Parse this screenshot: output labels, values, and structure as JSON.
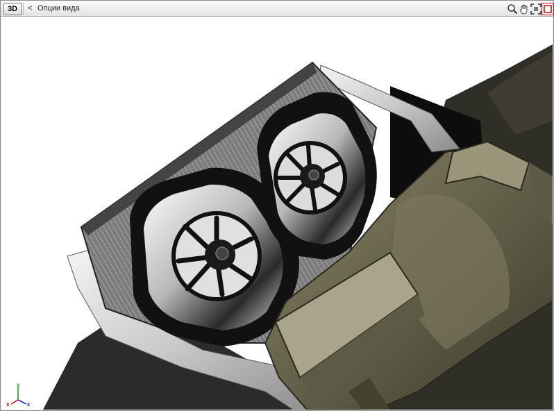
{
  "toolbar": {
    "view3d_label": "3D",
    "back_glyph": "<",
    "view_options_label": "Опции вида",
    "tools": [
      {
        "icon": "zoom-magnifier-icon"
      },
      {
        "icon": "pan-hand-icon"
      },
      {
        "icon": "fit-view-icon"
      },
      {
        "icon": "selection-box-icon",
        "active": true
      }
    ]
  },
  "viewport": {
    "background": "#ffffff",
    "axis_labels": {
      "x": "x",
      "y": "y",
      "z": "z"
    },
    "axis_colors": {
      "x": "#d00000",
      "y": "#00a000",
      "z": "#0000d0"
    }
  },
  "colors": {
    "metal_light": "#e6e6e6",
    "metal_dark": "#1e1e1e",
    "olive": "#6e6a52",
    "olive_light": "#9a957a"
  }
}
